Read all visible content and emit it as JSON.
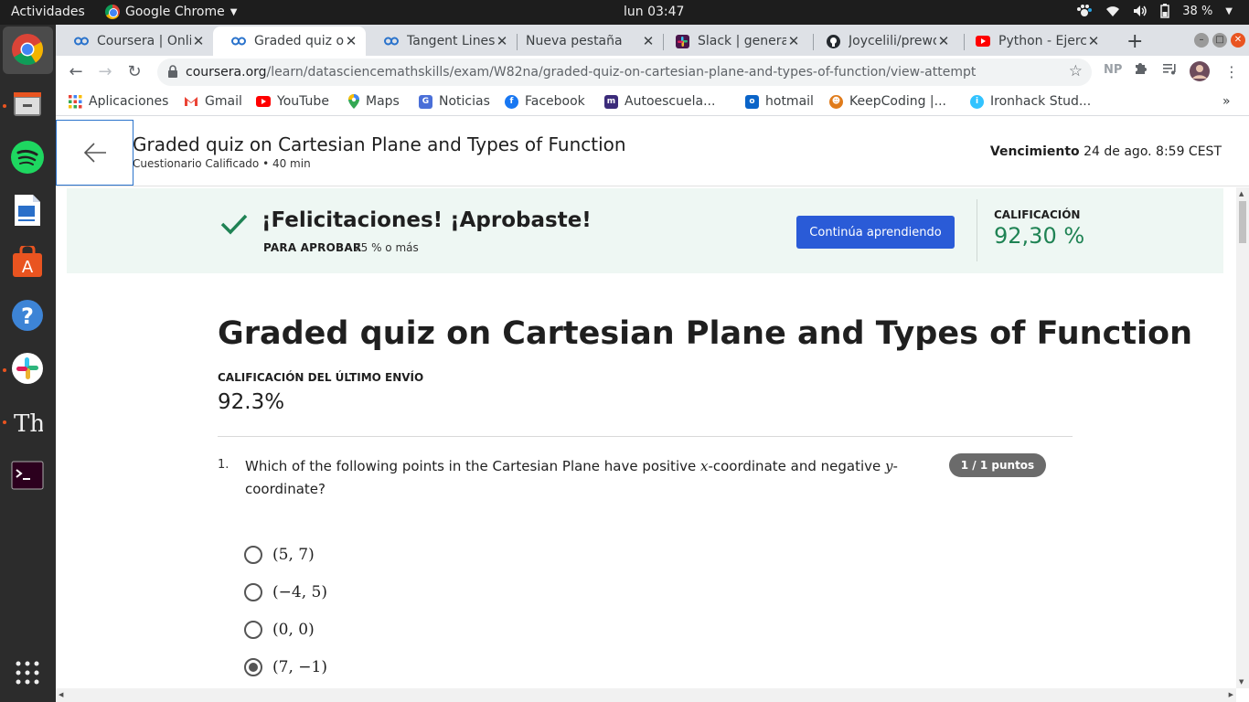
{
  "topbar": {
    "activities": "Actividades",
    "app_name": "Google Chrome",
    "clock": "lun 03:47",
    "battery": "38 %"
  },
  "tabs": [
    {
      "title": "Coursera | Onli",
      "icon": "coursera-icon",
      "active": false
    },
    {
      "title": "Graded quiz on",
      "icon": "coursera-icon",
      "active": true
    },
    {
      "title": "Tangent Lines",
      "icon": "coursera-icon",
      "active": false
    },
    {
      "title": "Nueva pestaña",
      "icon": "none",
      "active": false
    },
    {
      "title": "Slack | general",
      "icon": "slack-icon",
      "active": false
    },
    {
      "title": "Joycelili/prewo",
      "icon": "github-icon",
      "active": false
    },
    {
      "title": "Python - Ejerci",
      "icon": "youtube-icon",
      "active": false
    }
  ],
  "toolbar": {
    "url_host": "coursera.org",
    "url_path": "/learn/datasciencemathskills/exam/W82na/graded-quiz-on-cartesian-plane-and-types-of-function/view-attempt",
    "profile_initials": "NP"
  },
  "bookmarks": [
    {
      "label": "Aplicaciones",
      "icon": "apps-grid-icon"
    },
    {
      "label": "Gmail",
      "icon": "gmail-icon"
    },
    {
      "label": "YouTube",
      "icon": "youtube-icon"
    },
    {
      "label": "Maps",
      "icon": "maps-icon"
    },
    {
      "label": "Noticias",
      "icon": "news-icon"
    },
    {
      "label": "Facebook",
      "icon": "facebook-icon"
    },
    {
      "label": "Autoescuela...",
      "icon": "autoescuela-icon"
    },
    {
      "label": "hotmail",
      "icon": "outlook-icon"
    },
    {
      "label": "KeepCoding |...",
      "icon": "keepcoding-icon"
    },
    {
      "label": "Ironhack Stud...",
      "icon": "ironhack-icon"
    }
  ],
  "header": {
    "title": "Graded quiz on Cartesian Plane and Types of Function",
    "subtitle": "Cuestionario Calificado • 40 min",
    "due_label": "Vencimiento",
    "due_value": "24 de ago. 8:59 CEST"
  },
  "banner": {
    "congrats": "¡Felicitaciones! ¡Aprobaste!",
    "pass_label": "PARA APROBAR",
    "pass_value": "75 % o más",
    "continue_button": "Continúa aprendiendo",
    "grade_label": "CALIFICACIÓN",
    "grade_value": "92,30 %"
  },
  "main": {
    "title": "Graded quiz on Cartesian Plane and Types of Function",
    "last_label": "CALIFICACIÓN DEL ÚLTIMO ENVÍO",
    "last_value": "92.3%"
  },
  "question": {
    "number": "1.",
    "text_part1": "Which of the following points in the Cartesian Plane have positive ",
    "var_x": "x",
    "text_part2": "-coordinate and negative ",
    "var_y": "y",
    "text_part3": "-coordinate?",
    "points": "1 / 1 puntos",
    "options": [
      {
        "label": "(5, 7)",
        "selected": false
      },
      {
        "label": "(−4, 5)",
        "selected": false
      },
      {
        "label": "(0, 0)",
        "selected": false
      },
      {
        "label": "(7, −1)",
        "selected": true
      }
    ]
  },
  "colors": {
    "accent": "#2a5bd7",
    "success": "#1f8354",
    "banner_bg": "#eef7f3"
  }
}
